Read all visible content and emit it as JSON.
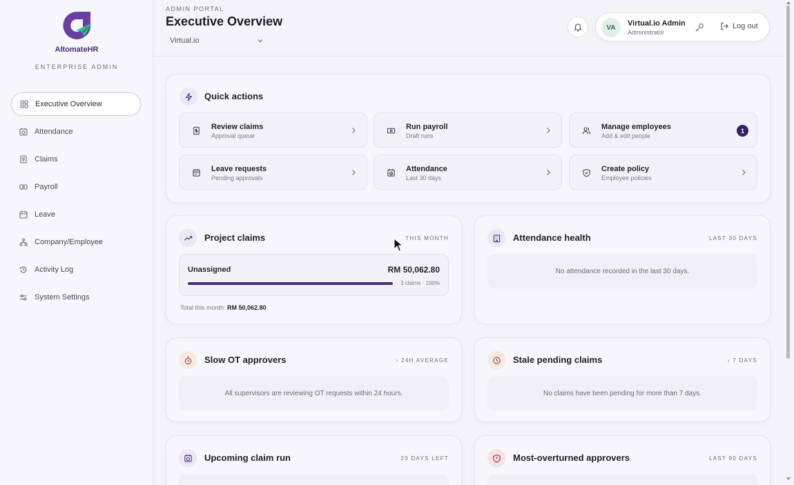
{
  "brand": {
    "name": "AltomateHR",
    "subtitle": "ENTERPRISE ADMIN"
  },
  "sidebar": {
    "items": [
      {
        "label": "Executive Overview",
        "icon": "grid-icon",
        "active": true
      },
      {
        "label": "Attendance",
        "icon": "calendar-clock-icon"
      },
      {
        "label": "Claims",
        "icon": "receipt-icon"
      },
      {
        "label": "Payroll",
        "icon": "banknote-icon"
      },
      {
        "label": "Leave",
        "icon": "calendar-icon"
      },
      {
        "label": "Company/Employee",
        "icon": "org-chart-icon"
      },
      {
        "label": "Activity Log",
        "icon": "history-icon"
      },
      {
        "label": "System Settings",
        "icon": "sliders-icon"
      }
    ]
  },
  "header": {
    "portal_label": "ADMIN PORTAL",
    "title": "Executive Overview",
    "org_select": "Virtual.io",
    "user": {
      "initials": "VA",
      "name": "Virtual.io Admin",
      "role": "Administrator"
    },
    "logout_label": "Log out"
  },
  "quick_actions": {
    "title": "Quick actions",
    "tiles": [
      {
        "label": "Review claims",
        "sub": "Approval queue",
        "icon": "receipt-icon"
      },
      {
        "label": "Run payroll",
        "sub": "Draft runs",
        "icon": "banknote-icon"
      },
      {
        "label": "Manage employees",
        "sub": "Add & edit people",
        "icon": "users-icon",
        "badge": "1"
      },
      {
        "label": "Leave requests",
        "sub": "Pending approvals",
        "icon": "calendar-icon"
      },
      {
        "label": "Attendance",
        "sub": "Last 30 days",
        "icon": "calendar-clock-icon"
      },
      {
        "label": "Create policy",
        "sub": "Employee policies",
        "icon": "shield-check-icon"
      }
    ]
  },
  "project_claims": {
    "title": "Project claims",
    "tag": "THIS MONTH",
    "row_label": "Unassigned",
    "row_amount": "RM 50,062.80",
    "row_meta": "3 claims · 100%",
    "progress_percent": 100,
    "total_label": "Total this month:",
    "total_value": "RM 50,062.80"
  },
  "attendance_health": {
    "title": "Attendance health",
    "tag": "LAST 30 DAYS",
    "empty": "No attendance recorded in the last 30 days."
  },
  "slow_ot": {
    "title": "Slow OT approvers",
    "tag": "› 24H AVERAGE",
    "empty": "All supervisors are reviewing OT requests within 24 hours."
  },
  "stale_claims": {
    "title": "Stale pending claims",
    "tag": "› 7 DAYS",
    "empty": "No claims have been pending for more than 7 days."
  },
  "upcoming_claim_run": {
    "title": "Upcoming claim run",
    "tag": "23 DAYS LEFT"
  },
  "most_overturned": {
    "title": "Most-overturned approvers",
    "tag": "LAST 90 DAYS"
  },
  "colors": {
    "brand": "#4b2a7a",
    "accent_green": "#2fbf8f",
    "badge": "#3b1c68"
  }
}
